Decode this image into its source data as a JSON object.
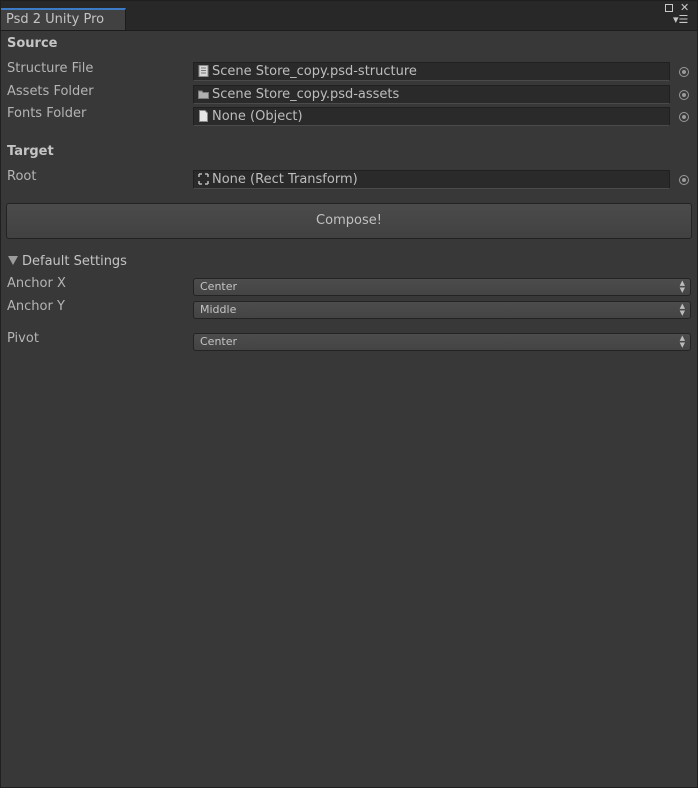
{
  "window": {
    "tab_title": "Psd 2 Unity Pro"
  },
  "source": {
    "header": "Source",
    "structure_file": {
      "label": "Structure File",
      "value": "Scene Store_copy.psd-structure",
      "icon": "document-icon"
    },
    "assets_folder": {
      "label": "Assets Folder",
      "value": "Scene Store_copy.psd-assets",
      "icon": "folder-icon"
    },
    "fonts_folder": {
      "label": "Fonts Folder",
      "value": "None (Object)",
      "icon": "blank-document-icon"
    }
  },
  "target": {
    "header": "Target",
    "root": {
      "label": "Root",
      "value": "None (Rect Transform)",
      "icon": "rect-transform-icon"
    }
  },
  "compose_label": "Compose!",
  "default_settings": {
    "label": "Default Settings",
    "anchor_x": {
      "label": "Anchor X",
      "value": "Center"
    },
    "anchor_y": {
      "label": "Anchor Y",
      "value": "Middle"
    },
    "pivot": {
      "label": "Pivot",
      "value": "Center"
    }
  },
  "colors": {
    "tab_accent": "#3d7bc7",
    "panel_bg": "#383838"
  }
}
